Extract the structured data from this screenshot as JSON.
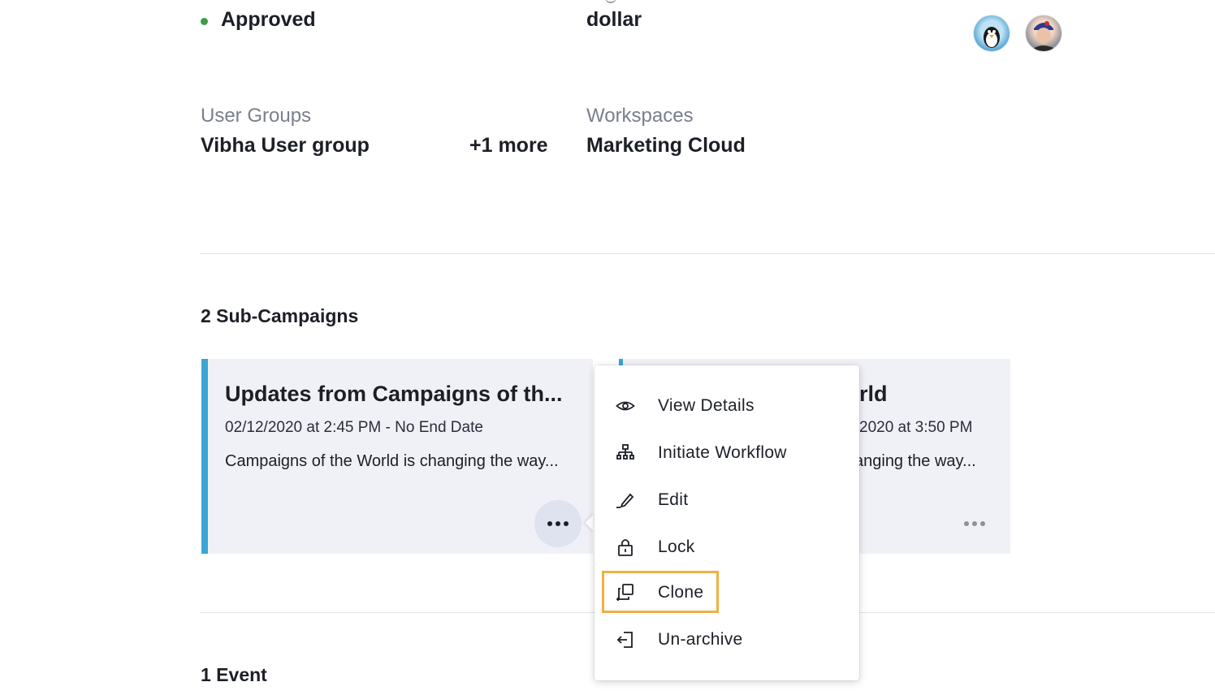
{
  "overview": {
    "status": "Approved",
    "currency": "dollar",
    "user_groups_label": "User Groups",
    "user_groups_value": "Vibha User group",
    "user_groups_more": "+1 more",
    "workspaces_label": "Workspaces",
    "workspaces_value": "Marketing Cloud",
    "status_color": "#3d9b4a"
  },
  "subcampaigns": {
    "title": "2 Sub-Campaigns",
    "cards": [
      {
        "title": "Updates from Campaigns of th...",
        "date": "02/12/2020 at 2:45 PM - No End Date",
        "description": "Campaigns of the World is changing the way..."
      },
      {
        "title": "rld",
        "date": "2020 at 3:50 PM",
        "description": "anging the way..."
      }
    ],
    "accent_color": "#3aa6d6"
  },
  "menu": {
    "items": [
      {
        "label": "View Details",
        "icon": "eye-icon"
      },
      {
        "label": "Initiate Workflow",
        "icon": "workflow-icon"
      },
      {
        "label": "Edit",
        "icon": "pencil-icon"
      },
      {
        "label": "Lock",
        "icon": "lock-icon"
      },
      {
        "label": "Clone",
        "icon": "clone-icon"
      },
      {
        "label": "Un-archive",
        "icon": "unarchive-icon"
      }
    ],
    "highlight_color": "#f0b042"
  },
  "events": {
    "title": "1 Event"
  }
}
